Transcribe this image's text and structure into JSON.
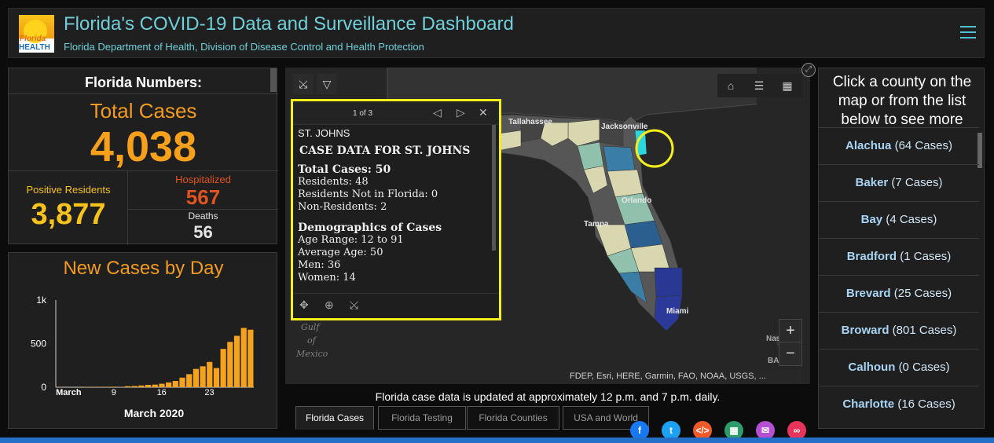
{
  "header": {
    "title": "Florida's COVID-19 Data and Surveillance Dashboard",
    "subtitle": "Florida Department of Health, Division of Disease Control and Health Protection",
    "logo_line1": "Florida",
    "logo_line2": "HEALTH"
  },
  "numbers": {
    "title": "Florida Numbers:",
    "total_label": "Total Cases",
    "total_value": "4,038",
    "positive_label": "Positive Residents",
    "positive_value": "3,877",
    "hospitalized_label": "Hospitalized",
    "hospitalized_value": "567",
    "deaths_label": "Deaths",
    "deaths_value": "56"
  },
  "chart_data": {
    "type": "bar",
    "title": "New Cases by Day",
    "xlabel": "March 2020",
    "ylabel": "",
    "ylim": [
      0,
      1000
    ],
    "yticks": [
      "0",
      "500",
      "1k"
    ],
    "xticks": [
      "March",
      "9",
      "16",
      "23"
    ],
    "categories": [
      "1",
      "2",
      "3",
      "4",
      "5",
      "6",
      "7",
      "8",
      "9",
      "10",
      "11",
      "12",
      "13",
      "14",
      "15",
      "16",
      "17",
      "18",
      "19",
      "20",
      "21",
      "22",
      "23",
      "24",
      "25",
      "26",
      "27",
      "28",
      "29"
    ],
    "values": [
      2,
      0,
      1,
      1,
      4,
      4,
      3,
      5,
      6,
      3,
      12,
      14,
      20,
      27,
      30,
      40,
      55,
      72,
      110,
      150,
      210,
      240,
      290,
      220,
      440,
      520,
      590,
      680,
      660
    ]
  },
  "map": {
    "tools": [
      "pan-icon",
      "dropdown-icon"
    ],
    "nav": [
      "home-icon",
      "list-icon",
      "qr-icon"
    ],
    "labels": {
      "tallahassee": "Tallahassee",
      "jacksonville": "Jacksonville",
      "orlando": "Orlando",
      "tampa": "Tampa",
      "miami": "Miami",
      "gulf": "Gulf",
      "of": "of",
      "mexico": "Mexico",
      "nas": "Nas",
      "ba": "BA"
    },
    "attribution": "FDEP, Esri, HERE, Garmin, FAO, NOAA, USGS, ...",
    "zoom_in": "+",
    "zoom_out": "−"
  },
  "popup": {
    "page": "1 of 3",
    "county": "ST. JOHNS",
    "heading": "CASE DATA FOR ST. JOHNS",
    "total_cases": "Total Cases: 50",
    "residents": "Residents: 48",
    "residents_not_fl": "Residents Not in Florida: 0",
    "non_residents": "Non-Residents: 2",
    "demographics_heading": "Demographics of Cases",
    "age_range": "Age Range: 12 to 91",
    "average_age": "Average Age: 50",
    "men": "Men: 36",
    "women": "Women: 14"
  },
  "update_note": "Florida case data is updated at approximately 12 p.m. and 7 p.m. daily.",
  "tabs": [
    "Florida Cases",
    "Florida Testing",
    "Florida Counties",
    "USA and World"
  ],
  "share": {
    "colors": [
      "#1877f2",
      "#1da1f2",
      "#f05a28",
      "#2e9c6a",
      "#b64fd4",
      "#e8335a"
    ],
    "icons": [
      "facebook-icon",
      "twitter-icon",
      "embed-icon",
      "qr-code-icon",
      "email-icon",
      "link-icon"
    ]
  },
  "counties": {
    "header": "Click a county on the map or from the list below to see more",
    "items": [
      {
        "name": "Alachua",
        "cases": "(64 Cases)"
      },
      {
        "name": "Baker",
        "cases": "(7 Cases)"
      },
      {
        "name": "Bay",
        "cases": "(4 Cases)"
      },
      {
        "name": "Bradford",
        "cases": "(1 Cases)"
      },
      {
        "name": "Brevard",
        "cases": "(25 Cases)"
      },
      {
        "name": "Broward",
        "cases": "(801 Cases)"
      },
      {
        "name": "Calhoun",
        "cases": "(0 Cases)"
      },
      {
        "name": "Charlotte",
        "cases": "(16 Cases)"
      }
    ]
  }
}
